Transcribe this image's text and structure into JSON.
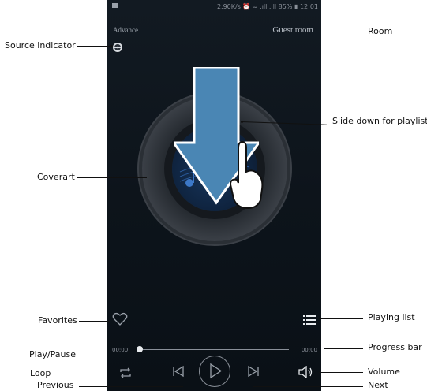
{
  "status_bar": {
    "right_text": "2.90K/s ⏰ ≈ .ıll .ıll 85% ▮ 12:01"
  },
  "header": {
    "mode_label": "Advance",
    "room_name": "Guest room"
  },
  "player": {
    "time_elapsed": "00:00",
    "time_total": "00:00"
  },
  "annotations": {
    "source_indicator": "Source indicator",
    "room": "Room",
    "slide_down": "Slide down for playlist",
    "coverart": "Coverart",
    "favorites": "Favorites",
    "playing_list": "Playing list",
    "play_pause": "Play/Pause",
    "progress_bar": "Progress bar",
    "loop": "Loop",
    "volume": "Volume",
    "previous": "Previous",
    "next": "Next"
  },
  "colors": {
    "screen_bg": "#0d141b",
    "arrow": "#4a86b4",
    "icon": "#9aa1aa"
  },
  "icons": [
    "source-icon",
    "heart-icon",
    "list-icon",
    "loop-icon",
    "previous-icon",
    "play-icon",
    "next-icon",
    "volume-icon",
    "swipe-down-arrow-icon",
    "hand-icon"
  ]
}
